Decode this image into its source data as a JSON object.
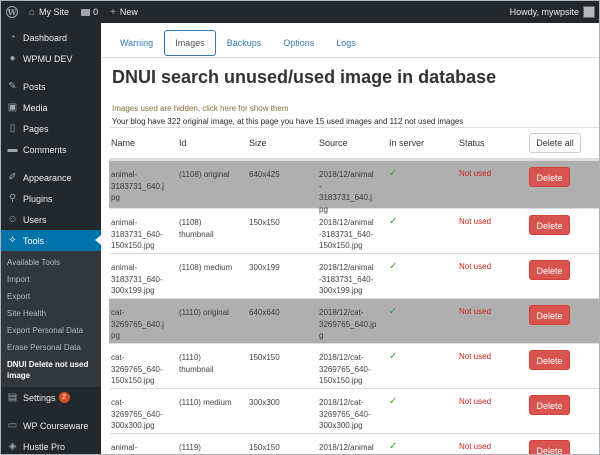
{
  "adminbar": {
    "site_name": "My Site",
    "comments_count": "0",
    "new_label": "New",
    "greeting": "Howdy, mywpsite"
  },
  "sidebar": {
    "items": [
      {
        "label": "Dashboard",
        "icon": "dashboard-icon"
      },
      {
        "label": "WPMU DEV",
        "icon": "wpmudev-icon"
      },
      {
        "label": "Posts",
        "icon": "pin-icon"
      },
      {
        "label": "Media",
        "icon": "media-icon"
      },
      {
        "label": "Pages",
        "icon": "pages-icon"
      },
      {
        "label": "Comments",
        "icon": "comment-icon"
      },
      {
        "label": "Appearance",
        "icon": "brush-icon"
      },
      {
        "label": "Plugins",
        "icon": "plugin-icon"
      },
      {
        "label": "Users",
        "icon": "users-icon"
      },
      {
        "label": "Tools",
        "icon": "wrench-icon"
      },
      {
        "label": "Settings",
        "icon": "settings-icon",
        "badge": "2"
      },
      {
        "label": "WP Courseware",
        "icon": "courseware-icon"
      },
      {
        "label": "Hustle Pro",
        "icon": "hustle-icon"
      }
    ],
    "tools_submenu": [
      "Available Tools",
      "Import",
      "Export",
      "Site Health",
      "Export Personal Data",
      "Erase Personal Data",
      "DNUI Delete not used image"
    ]
  },
  "tabs": [
    "Warning",
    "Images",
    "Backups",
    "Options",
    "Logs"
  ],
  "active_tab": "Images",
  "page_title": "DNUI search unused/used image in database",
  "hidden_link": "Images used are hidden, click here for show them",
  "summary": "Your blog have 322 original image, at this page you have 15 used images and 112 not used images",
  "table": {
    "headers": [
      "Name",
      "Id",
      "Size",
      "Source",
      "In server",
      "Status"
    ],
    "delete_all_label": "Delete all",
    "delete_label": "Delete",
    "check_mark": "✓",
    "rows": [
      {
        "name": "animal-\n3183731_640.j\npg",
        "id": "(1108) original",
        "size": "640x425",
        "source": "2018/12/animal\n-\n3183731_640.j\npg",
        "status": "Not used",
        "gray": true
      },
      {
        "name": "animal-\n3183731_640-\n150x150.jpg",
        "id": "(1108)\nthumbnail",
        "size": "150x150",
        "source": "2018/12/animal\n-3183731_640-\n150x150.jpg",
        "status": "Not used",
        "gray": false
      },
      {
        "name": "animal-\n3183731_640-\n300x199.jpg",
        "id": "(1108) medium",
        "size": "300x199",
        "source": "2018/12/animal\n-3183731_640-\n300x199.jpg",
        "status": "Not used",
        "gray": false
      },
      {
        "name": "cat-\n3269765_640.j\npg",
        "id": "(1110) original",
        "size": "640x640",
        "source": "2018/12/cat-\n3269765_640.jp\ng",
        "status": "Not used",
        "gray": true
      },
      {
        "name": "cat-\n3269765_640-\n150x150.jpg",
        "id": "(1110)\nthumbnail",
        "size": "150x150",
        "source": "2018/12/cat-\n3269765_640-\n150x150.jpg",
        "status": "Not used",
        "gray": false
      },
      {
        "name": "cat-\n3269765_640-\n300x300.jpg",
        "id": "(1110) medium",
        "size": "300x300",
        "source": "2018/12/cat-\n3269765_640-\n300x300.jpg",
        "status": "Not used",
        "gray": false
      },
      {
        "name": "animal-",
        "id": "(1119)",
        "size": "150x150",
        "source": "2018/12/animal",
        "status": "Not used",
        "gray": false
      }
    ]
  }
}
